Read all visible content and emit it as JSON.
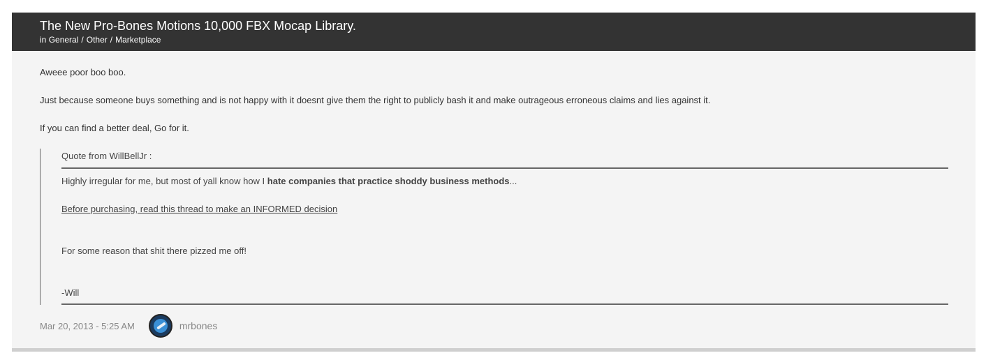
{
  "thread": {
    "title": "The New Pro-Bones Motions 10,000 FBX Mocap Library.",
    "breadcrumb_prefix": "in",
    "breadcrumb": [
      "General",
      "Other",
      "Marketplace"
    ],
    "breadcrumb_separator": "/"
  },
  "post": {
    "paragraphs": [
      "Aweee poor boo boo.",
      "Just because someone buys something and is not happy with it doesnt give them the right to publicly bash it and make outrageous erroneous claims and lies against it.",
      "If you can find a better deal, Go for it."
    ],
    "quote": {
      "from": "Quote from WillBellJr :",
      "line1_start": "Highly irregular for me, but most of yall know how I ",
      "line1_bold": "hate companies that practice shoddy business methods",
      "line1_end": "...",
      "link_text": "Before purchasing, read this thread to make an INFORMED decision",
      "line3": "For some reason that shit there pizzed me off!",
      "signature": "-Will"
    },
    "date": "Mar 20, 2013 - 5:25 AM",
    "author": "mrbones",
    "avatar_icon": "bones-avatar"
  },
  "colors": {
    "header_bg": "#333333",
    "post_bg": "#f4f4f4",
    "text": "#333333",
    "muted": "#888888"
  }
}
